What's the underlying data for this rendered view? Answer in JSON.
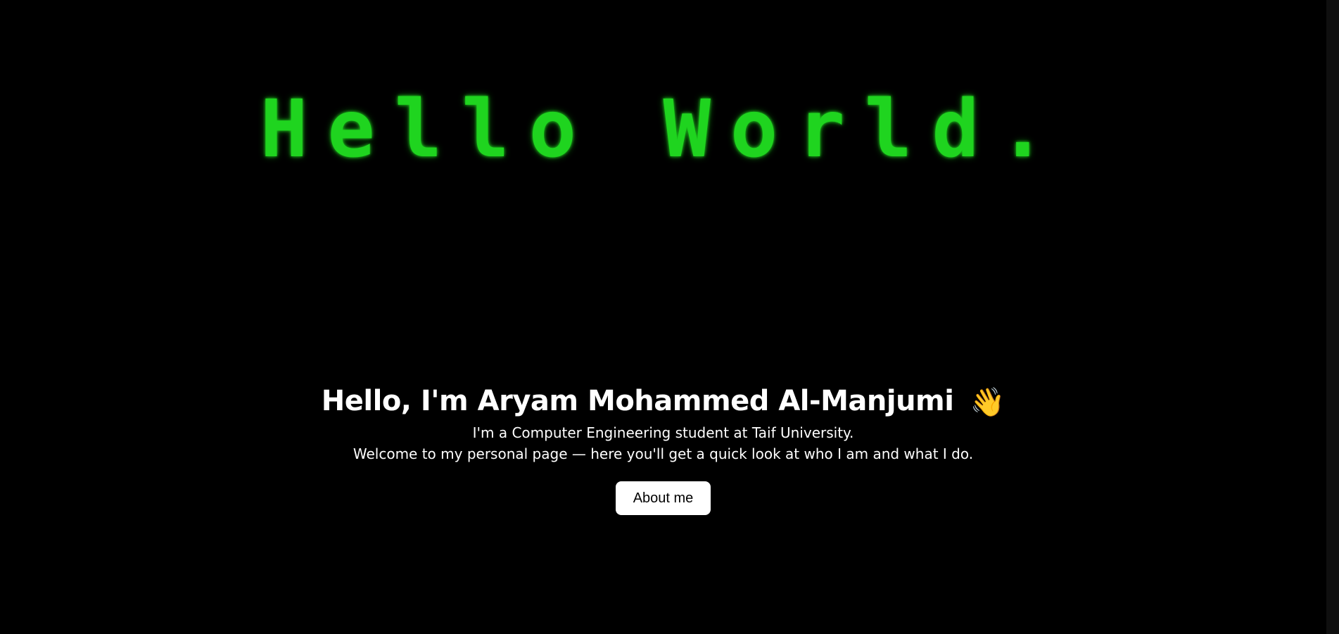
{
  "hero": {
    "banner_text": "Hello World."
  },
  "intro": {
    "heading": "Hello, I'm Aryam Mohammed Al-Manjumi",
    "heading_icon": "👋",
    "line1": "I'm a Computer Engineering student at Taif University.",
    "line2": "Welcome to my personal page — here you'll get a quick look at who I am and what I do."
  },
  "actions": {
    "about_label": "About me"
  },
  "colors": {
    "background": "#000000",
    "accent_green": "#1fd41f",
    "text": "#ffffff",
    "button_bg": "#ffffff",
    "button_text": "#000000"
  }
}
